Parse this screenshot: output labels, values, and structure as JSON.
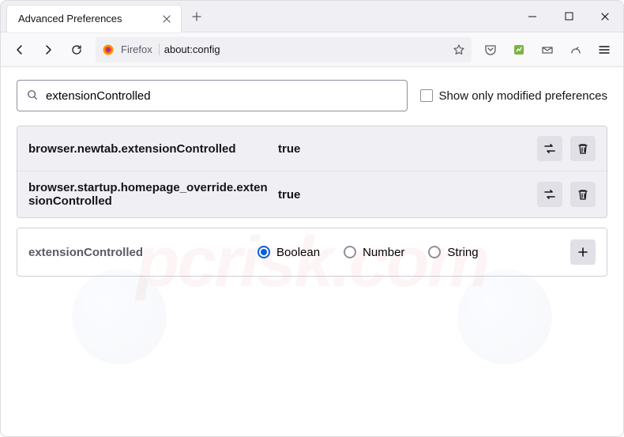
{
  "tab": {
    "title": "Advanced Preferences"
  },
  "urlbar": {
    "identity": "Firefox",
    "url": "about:config"
  },
  "search": {
    "value": "extensionControlled",
    "checkbox_label": "Show only modified preferences"
  },
  "prefs": [
    {
      "name": "browser.newtab.extensionControlled",
      "value": "true"
    },
    {
      "name": "browser.startup.homepage_override.extensionControlled",
      "value": "true"
    }
  ],
  "add": {
    "name": "extensionControlled",
    "types": [
      "Boolean",
      "Number",
      "String"
    ],
    "selected": "Boolean"
  },
  "watermark": "pcrisk.com"
}
